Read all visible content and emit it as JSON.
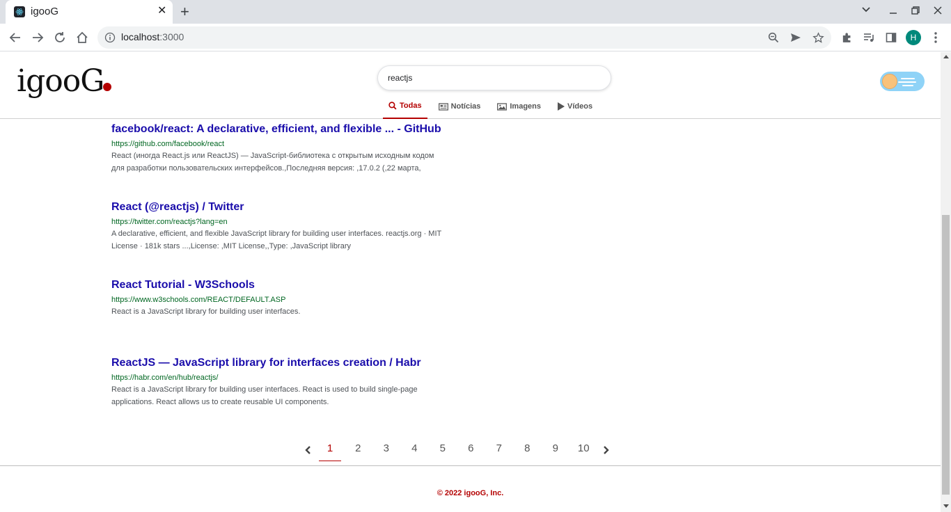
{
  "browser": {
    "tab_title": "igooG",
    "url_host": "localhost",
    "url_port": ":3000",
    "profile_initial": "H"
  },
  "header": {
    "logo": "igooG",
    "search_value": "reactjs",
    "nav_tabs": [
      {
        "label": "Todas",
        "icon": "search-icon",
        "active": true
      },
      {
        "label": "Notícias",
        "icon": "newspaper-icon",
        "active": false
      },
      {
        "label": "Imagens",
        "icon": "image-icon",
        "active": false
      },
      {
        "label": "Vídeos",
        "icon": "play-icon",
        "active": false
      }
    ]
  },
  "results": [
    {
      "title": "facebook/react: A declarative, efficient, and flexible ... - GitHub",
      "url": "https://github.com/facebook/react",
      "desc": "React (иногда React.js или ReactJS) — JavaScript-библиотека с открытым исходным кодом для разработки пользовательских интерфейсов.,Последняя версия: ,17.0.2 (,22 марта,"
    },
    {
      "title": "React (@reactjs) / Twitter",
      "url": "https://twitter.com/reactjs?lang=en",
      "desc": "A declarative, efficient, and flexible JavaScript library for building user interfaces. reactjs.org · MIT License · 181k stars ...,License: ,MIT License,,Type: ,JavaScript library"
    },
    {
      "title": "React Tutorial - W3Schools",
      "url": "https://www.w3schools.com/REACT/DEFAULT.ASP",
      "desc": "React is a JavaScript library for building user interfaces."
    },
    {
      "title": "ReactJS — JavaScript library for interfaces creation / Habr",
      "url": "https://habr.com/en/hub/reactjs/",
      "desc": "React is a JavaScript library for building user interfaces. React is used to build single-page applications. React allows us to create reusable UI components."
    }
  ],
  "pagination": {
    "pages": [
      "1",
      "2",
      "3",
      "4",
      "5",
      "6",
      "7",
      "8",
      "9",
      "10"
    ],
    "current": "1"
  },
  "footer": "© 2022 igooG, Inc.",
  "colors": {
    "accent": "#b40000",
    "link": "#1a0dab",
    "url": "#006621"
  }
}
